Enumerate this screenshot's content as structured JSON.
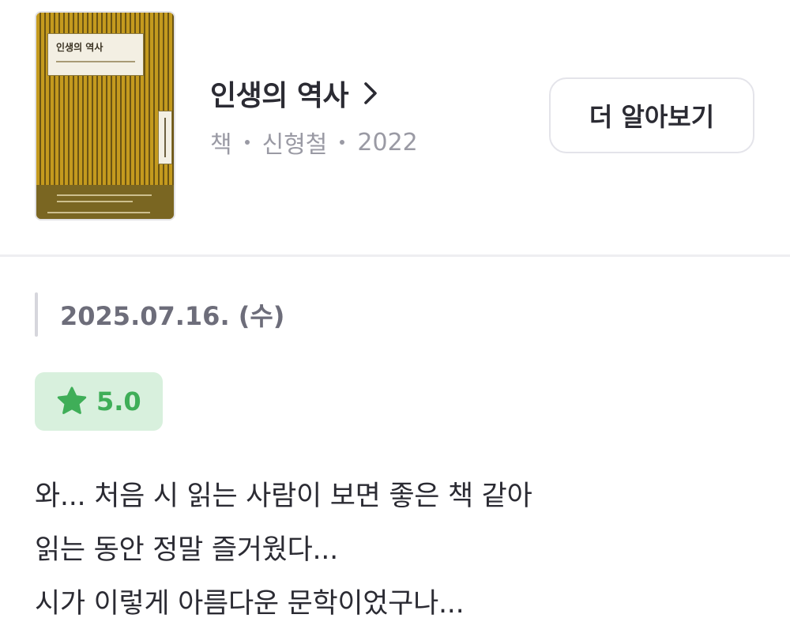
{
  "book": {
    "title": "인생의 역사",
    "meta": {
      "type": "책",
      "author": "신형철",
      "year": "2022"
    },
    "more_label": "더 알아보기",
    "cover": {
      "title": "인생의 역사",
      "colors": {
        "stripe_light": "#c49a1e",
        "stripe_dark": "#6b5414",
        "bottom": "#7a6622"
      }
    }
  },
  "review": {
    "date": "2025.07.16. (수)",
    "rating": {
      "value": "5.0",
      "icon": "star-icon",
      "color": "#3fae58",
      "background": "#d8f0dd"
    },
    "lines": [
      "와... 처음 시 읽는 사람이 보면 좋은 책 같아",
      "읽는 동안 정말 즐거웠다...",
      "시가 이렇게 아름다운 문학이었구나..."
    ]
  },
  "icons": {
    "title_chevron": "chevron-right-icon"
  }
}
